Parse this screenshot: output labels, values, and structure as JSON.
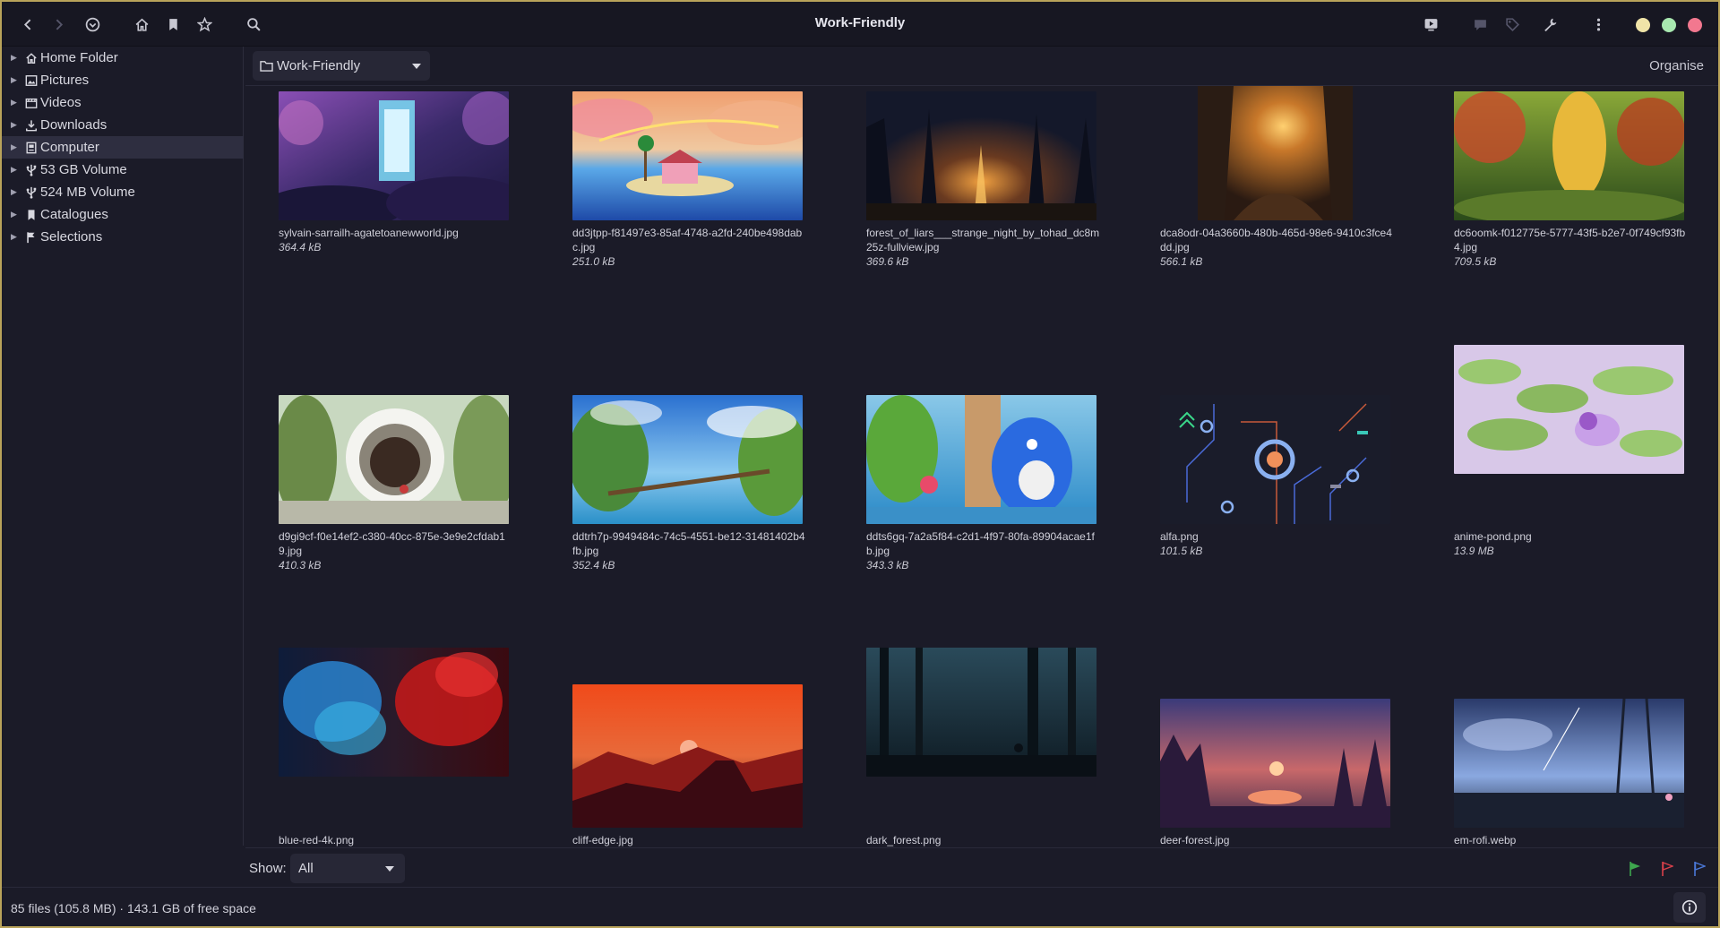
{
  "window": {
    "title": "Work-Friendly"
  },
  "toolbar": {
    "icons": [
      "go-back-icon",
      "go-forward-icon",
      "history-icon",
      "home-icon",
      "bookmark-icon",
      "star-icon",
      "search-icon",
      "slideshow-icon",
      "comment-icon",
      "tag-icon",
      "wrench-icon",
      "menu-icon"
    ]
  },
  "window_controls": [
    {
      "name": "minimize",
      "color": "#f0e4a8"
    },
    {
      "name": "maximize",
      "color": "#a8e8b0"
    },
    {
      "name": "close",
      "color": "#f2788f"
    }
  ],
  "sidebar": {
    "items": [
      {
        "label": "Home Folder",
        "icon": "home-icon",
        "selected": false
      },
      {
        "label": "Pictures",
        "icon": "pictures-icon",
        "selected": false
      },
      {
        "label": "Videos",
        "icon": "videos-icon",
        "selected": false
      },
      {
        "label": "Downloads",
        "icon": "download-icon",
        "selected": false
      },
      {
        "label": "Computer",
        "icon": "computer-icon",
        "selected": true
      },
      {
        "label": "53 GB Volume",
        "icon": "usb-icon",
        "selected": false
      },
      {
        "label": "524 MB Volume",
        "icon": "usb-icon",
        "selected": false
      },
      {
        "label": "Catalogues",
        "icon": "bookmark-icon",
        "selected": false
      },
      {
        "label": "Selections",
        "icon": "flag-icon",
        "selected": false
      }
    ]
  },
  "location": {
    "path": "Work-Friendly",
    "organise_label": "Organise"
  },
  "files": [
    {
      "name": "sylvain-sarrailh-agatetoanewworld.jpg",
      "size": "364.4 kB"
    },
    {
      "name": "dd3jtpp-f81497e3-85af-4748-a2fd-240be498dabc.jpg",
      "size": "251.0 kB"
    },
    {
      "name": "forest_of_liars___strange_night_by_tohad_dc8m25z-fullview.jpg",
      "size": "369.6 kB"
    },
    {
      "name": "dca8odr-04a3660b-480b-465d-98e6-9410c3fce4dd.jpg",
      "size": "566.1 kB"
    },
    {
      "name": "dc6oomk-f012775e-5777-43f5-b2e7-0f749cf93fb4.jpg",
      "size": "709.5 kB"
    },
    {
      "name": "d9gi9cf-f0e14ef2-c380-40cc-875e-3e9e2cfdab19.jpg",
      "size": "410.3 kB"
    },
    {
      "name": "ddtrh7p-9949484c-74c5-4551-be12-31481402b4fb.jpg",
      "size": "352.4 kB"
    },
    {
      "name": "ddts6gq-7a2a5f84-c2d1-4f97-80fa-89904acae1fb.jpg",
      "size": "343.3 kB"
    },
    {
      "name": "alfa.png",
      "size": "101.5 kB"
    },
    {
      "name": "anime-pond.png",
      "size": "13.9 MB"
    },
    {
      "name": "blue-red-4k.png",
      "size": ""
    },
    {
      "name": "cliff-edge.jpg",
      "size": ""
    },
    {
      "name": "dark_forest.png",
      "size": ""
    },
    {
      "name": "deer-forest.jpg",
      "size": ""
    },
    {
      "name": "em-rofi.webp",
      "size": ""
    }
  ],
  "filter": {
    "show_label": "Show:",
    "show_value": "All"
  },
  "flags": [
    {
      "name": "green-flag-icon",
      "color": "#3ea64e"
    },
    {
      "name": "red-flag-icon",
      "color": "#d8404a"
    },
    {
      "name": "blue-flag-icon",
      "color": "#4a78d8"
    }
  ],
  "status": {
    "text": "85 files (105.8 MB) · 143.1 GB of free space"
  }
}
